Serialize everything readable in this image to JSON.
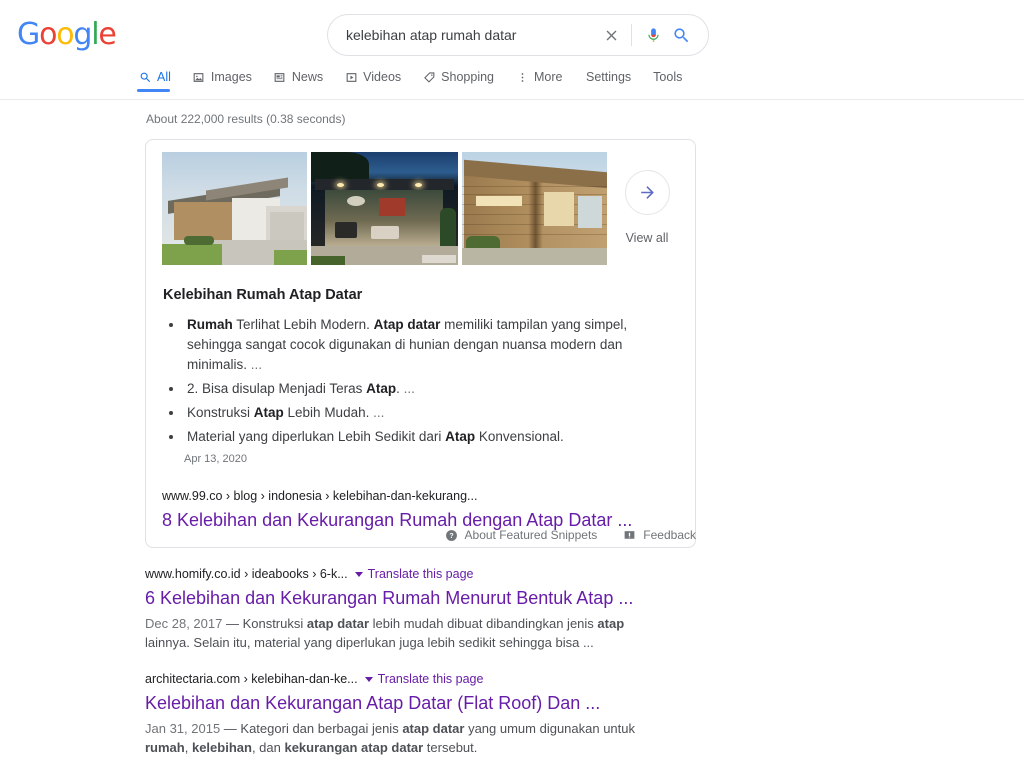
{
  "header": {
    "logo_letters": [
      {
        "ch": "G",
        "color": "#4285f4"
      },
      {
        "ch": "o",
        "color": "#ea4335"
      },
      {
        "ch": "o",
        "color": "#fbbc05"
      },
      {
        "ch": "g",
        "color": "#4285f4"
      },
      {
        "ch": "l",
        "color": "#34a853"
      },
      {
        "ch": "e",
        "color": "#ea4335"
      }
    ],
    "search": {
      "value": "kelebihan atap rumah datar",
      "placeholder": "Search",
      "clear_icon": "close-icon",
      "mic_icon": "microphone-icon",
      "search_icon": "search-icon"
    },
    "tabs": [
      {
        "label": "All",
        "icon": "search-icon",
        "active": true
      },
      {
        "label": "Images",
        "icon": "image-icon",
        "active": false
      },
      {
        "label": "News",
        "icon": "news-icon",
        "active": false
      },
      {
        "label": "Videos",
        "icon": "video-icon",
        "active": false
      },
      {
        "label": "Shopping",
        "icon": "tag-icon",
        "active": false
      },
      {
        "label": "More",
        "icon": "more-vertical-icon",
        "active": false
      }
    ],
    "right_links": [
      {
        "label": "Settings"
      },
      {
        "label": "Tools"
      }
    ]
  },
  "results_meta": {
    "count_text": "About 222,000 results (0.38 seconds)"
  },
  "featured_snippet": {
    "thumbnails": [
      {
        "alt": "modern-house-flat-roof-photo"
      },
      {
        "alt": "glass-pavilion-night-photo"
      },
      {
        "alt": "wood-clad-flat-roof-photo"
      }
    ],
    "view_all": {
      "label": "View all",
      "icon": "arrow-right-icon"
    },
    "title": "Kelebihan Rumah Atap Datar",
    "bullets": [
      {
        "parts": [
          {
            "text": "Rumah",
            "bold": true
          },
          {
            "text": " Terlihat Lebih Modern. ",
            "bold": false
          },
          {
            "text": "Atap datar",
            "bold": true
          },
          {
            "text": " memiliki tampilan yang simpel, sehingga sangat cocok digunakan di hunian dengan nuansa modern dan minimalis. ",
            "bold": false
          },
          {
            "text": "...",
            "bold": false,
            "muted": true
          }
        ]
      },
      {
        "parts": [
          {
            "text": "2. Bisa disulap Menjadi Teras ",
            "bold": false
          },
          {
            "text": "Atap",
            "bold": true
          },
          {
            "text": ". ",
            "bold": false
          },
          {
            "text": "...",
            "bold": false,
            "muted": true
          }
        ]
      },
      {
        "parts": [
          {
            "text": "Konstruksi ",
            "bold": false
          },
          {
            "text": "Atap",
            "bold": true
          },
          {
            "text": " Lebih Mudah. ",
            "bold": false
          },
          {
            "text": "...",
            "bold": false,
            "muted": true
          }
        ]
      },
      {
        "parts": [
          {
            "text": "Material yang diperlukan Lebih Sedikit dari ",
            "bold": false
          },
          {
            "text": "Atap",
            "bold": true
          },
          {
            "text": " Konvensional.",
            "bold": false
          }
        ]
      }
    ],
    "date": "Apr 13, 2020",
    "source_url": "www.99.co › blog › indonesia › kelebihan-dan-kekurang...",
    "source_title": "8 Kelebihan dan Kekurangan Rumah dengan Atap Datar ...",
    "footer": [
      {
        "label": "About Featured Snippets",
        "icon": "help-circle-icon"
      },
      {
        "label": "Feedback",
        "icon": "feedback-flag-icon"
      }
    ]
  },
  "organic_results": [
    {
      "url": "www.homify.co.id › ideabooks › 6-k...",
      "translate_label": "Translate this page",
      "title": "6 Kelebihan dan Kekurangan Rumah Menurut Bentuk Atap ...",
      "snippet_parts": [
        {
          "text": "Dec 28, 2017",
          "style": "date"
        },
        {
          "text": " — Konstruksi ",
          "style": "normal"
        },
        {
          "text": "atap datar",
          "style": "bold"
        },
        {
          "text": " lebih mudah dibuat dibandingkan jenis ",
          "style": "normal"
        },
        {
          "text": "atap",
          "style": "bold"
        },
        {
          "text": " lainnya. Selain itu, material yang diperlukan juga lebih sedikit sehingga bisa ...",
          "style": "normal"
        }
      ]
    },
    {
      "url": "architectaria.com › kelebihan-dan-ke...",
      "translate_label": "Translate this page",
      "title": "Kelebihan dan Kekurangan Atap Datar (Flat Roof) Dan ...",
      "snippet_parts": [
        {
          "text": "Jan 31, 2015",
          "style": "date"
        },
        {
          "text": " — Kategori dan berbagai jenis ",
          "style": "normal"
        },
        {
          "text": "atap datar",
          "style": "bold"
        },
        {
          "text": " yang umum digunakan untuk ",
          "style": "normal"
        },
        {
          "text": "rumah",
          "style": "bold"
        },
        {
          "text": ", ",
          "style": "normal"
        },
        {
          "text": "kelebihan",
          "style": "bold"
        },
        {
          "text": ", dan ",
          "style": "normal"
        },
        {
          "text": "kekurangan atap datar",
          "style": "bold"
        },
        {
          "text": " tersebut.",
          "style": "normal"
        }
      ]
    }
  ],
  "colors": {
    "link": "#681da8",
    "accent_blue": "#4285f4",
    "tab_active": "#1a73e8",
    "text_gray": "#70757a"
  }
}
